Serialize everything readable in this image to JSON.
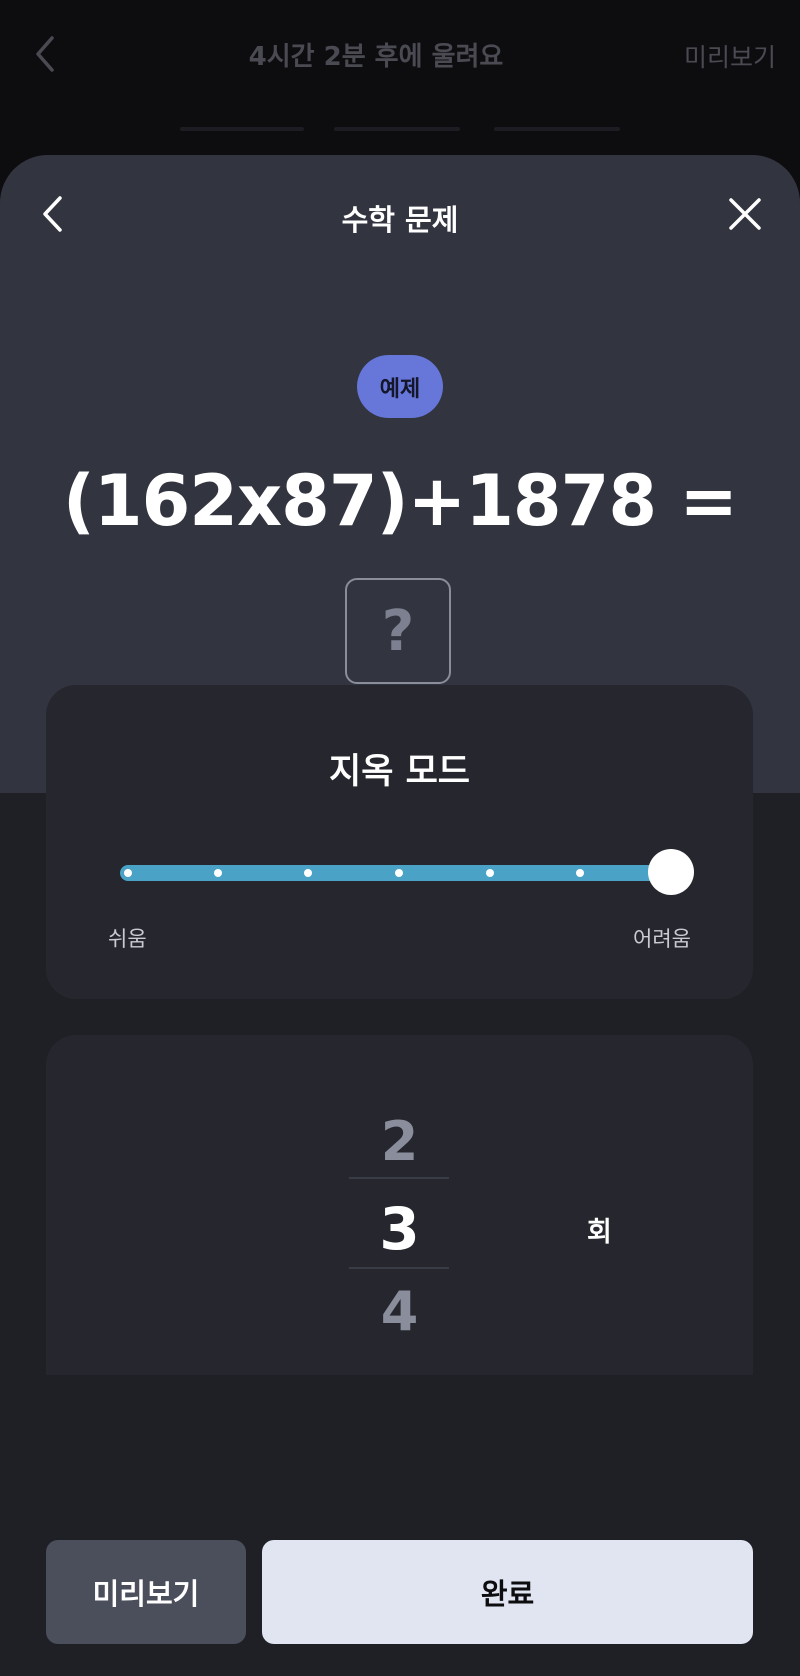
{
  "background": {
    "title": "4시간 2분 후에 울려요",
    "preview_label": "미리보기"
  },
  "sheet": {
    "title": "수학 문제"
  },
  "example": {
    "badge": "예제",
    "equation": "(162x87)+1878 =",
    "answer_placeholder": "?"
  },
  "difficulty": {
    "title": "지옥 모드",
    "min_label": "쉬움",
    "max_label": "어려움",
    "level": 7,
    "max_level": 7
  },
  "count_picker": {
    "prev": "2",
    "current": "3",
    "next": "4",
    "unit": "회"
  },
  "actions": {
    "preview": "미리보기",
    "done": "완료"
  },
  "colors": {
    "accent_badge": "#6776d9",
    "slider_track": "#4aa3c7",
    "done_button": "#e1e5f1"
  }
}
